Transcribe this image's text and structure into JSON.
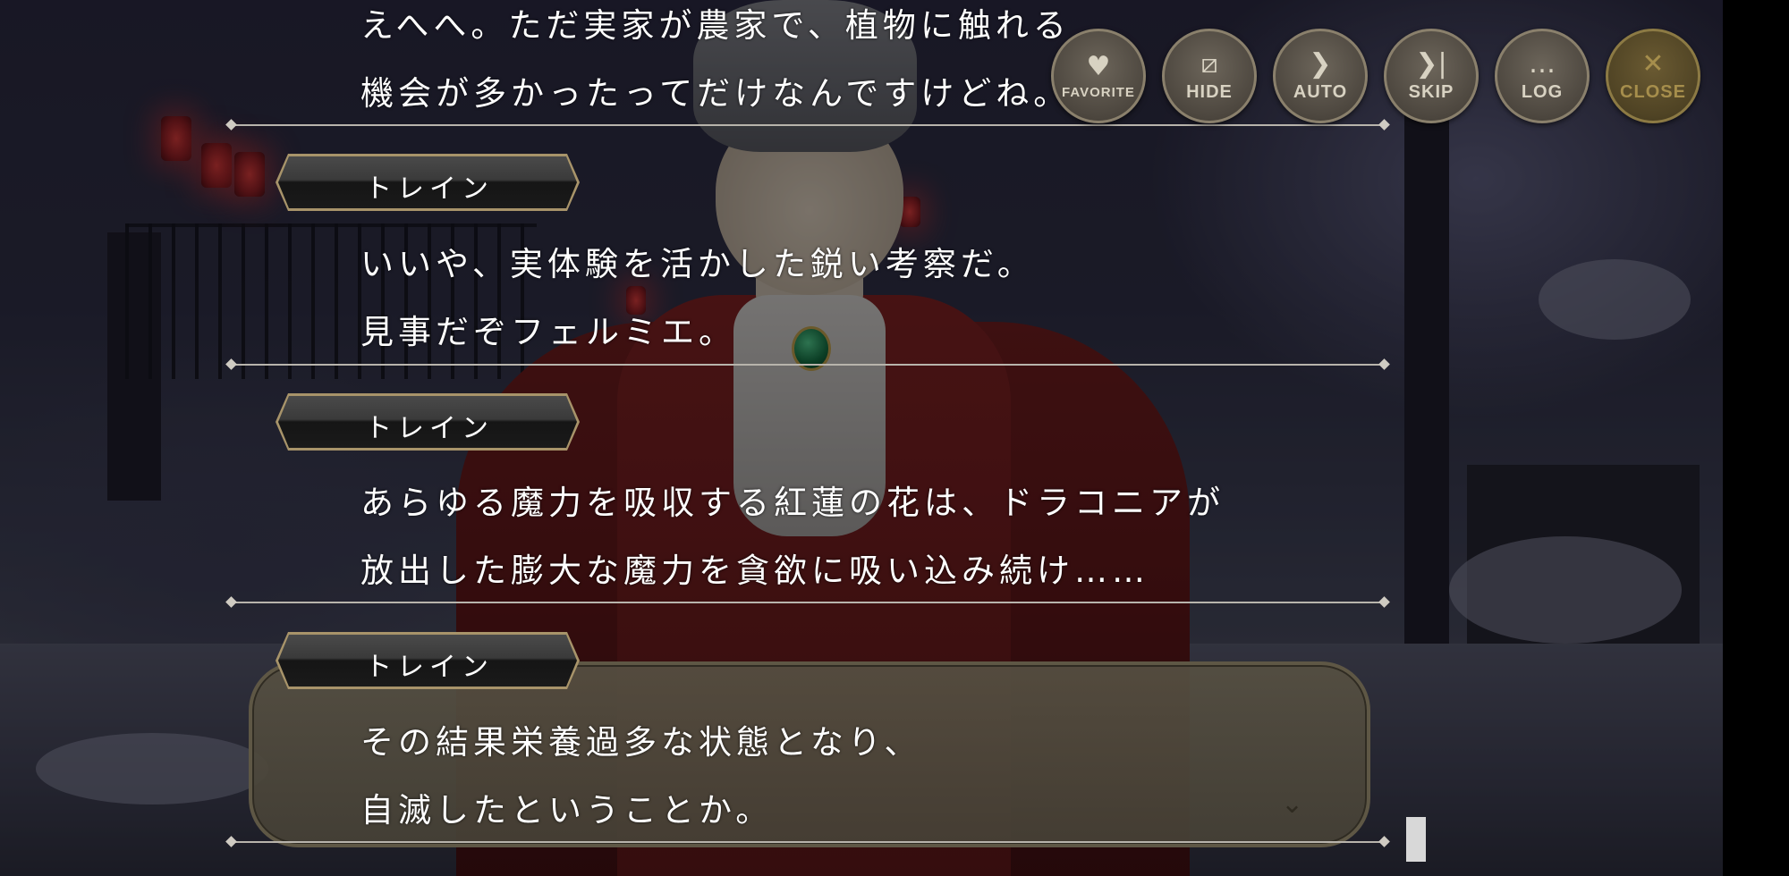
{
  "top_buttons": {
    "favorite": {
      "label": "FAVORITE",
      "icon": "heart-icon"
    },
    "hide": {
      "label": "HIDE",
      "icon": "hide-icon"
    },
    "auto": {
      "label": "AUTO",
      "icon": "play-icon"
    },
    "skip": {
      "label": "SKIP",
      "icon": "skip-icon"
    },
    "log": {
      "label": "LOG",
      "icon": "chat-bubble-icon"
    },
    "close": {
      "label": "CLOSE",
      "icon": "close-icon"
    }
  },
  "log": {
    "entry0": {
      "lines": [
        "えへへ。ただ実家が農家で、植物に触れる",
        "機会が多かったってだけなんですけどね。"
      ]
    },
    "entry1": {
      "speaker": "トレイン",
      "lines": [
        "いいや、実体験を活かした鋭い考察だ。",
        "見事だぞフェルミエ。"
      ]
    },
    "entry2": {
      "speaker": "トレイン",
      "lines": [
        "あらゆる魔力を吸収する紅蓮の花は、ドラコニアが",
        "放出した膨大な魔力を貪欲に吸い込み続け……"
      ]
    },
    "entry3": {
      "speaker": "トレイン",
      "lines": [
        "その結果栄養過多な状態となり、",
        "自滅したということか。"
      ]
    }
  },
  "colors": {
    "button_fill": "#4d473f",
    "close_fill": "#4f4324",
    "nameplate_border": "#a8946a",
    "text": "#ffffff"
  }
}
